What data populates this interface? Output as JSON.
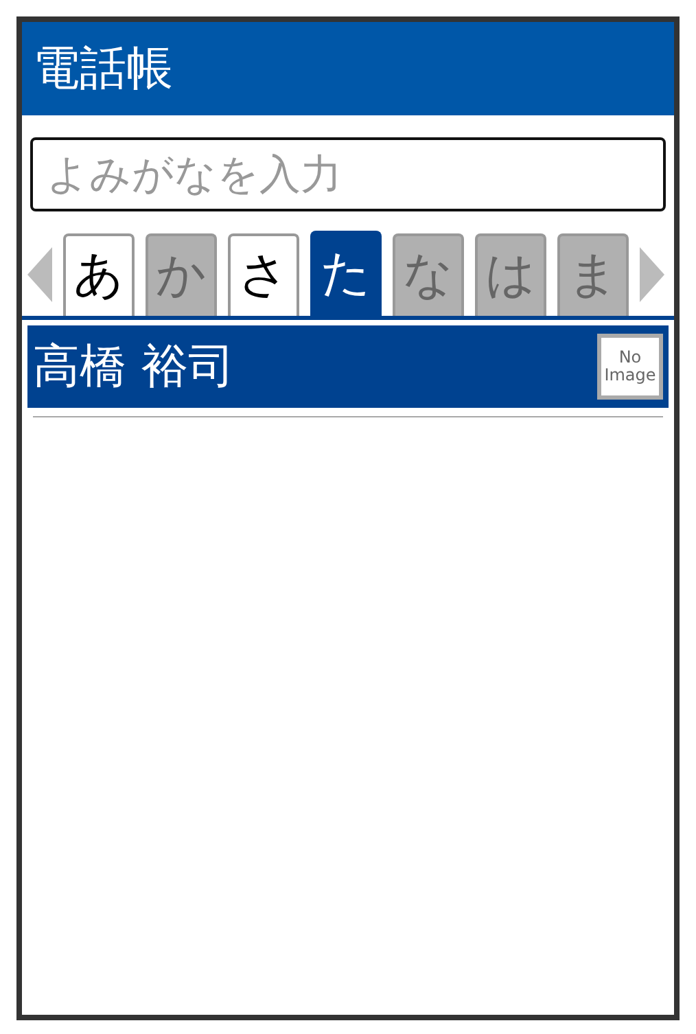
{
  "header": {
    "title": "電話帳"
  },
  "search": {
    "placeholder": "よみがなを入力"
  },
  "index_tabs": [
    {
      "label": "あ",
      "selected": false,
      "disabled": false
    },
    {
      "label": "か",
      "selected": false,
      "disabled": true
    },
    {
      "label": "さ",
      "selected": false,
      "disabled": false
    },
    {
      "label": "た",
      "selected": true,
      "disabled": false
    },
    {
      "label": "な",
      "selected": false,
      "disabled": true
    },
    {
      "label": "は",
      "selected": false,
      "disabled": true
    },
    {
      "label": "ま",
      "selected": false,
      "disabled": true
    }
  ],
  "contacts": [
    {
      "name": "高橋 裕司",
      "photo": "No Image",
      "selected": true
    }
  ]
}
